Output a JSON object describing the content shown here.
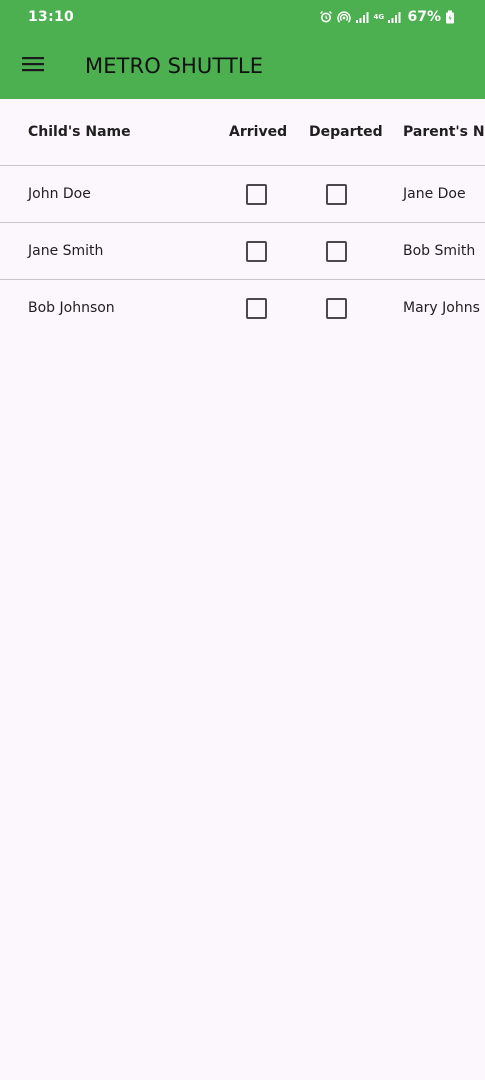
{
  "status_bar": {
    "time": "13:10",
    "icons": [
      "alarm-icon",
      "hotspot-icon",
      "signal-icon",
      "4g-icon",
      "signal-icon"
    ],
    "network_label": "4G",
    "battery_text": "67%",
    "text_color": "#ffffff"
  },
  "app_bar": {
    "title": "METRO SHUTTLE",
    "menu_icon": "menu-icon",
    "background_color": "#4caf50"
  },
  "table": {
    "columns": [
      "Child's Name",
      "Arrived",
      "Departed",
      "Parent's Na"
    ],
    "rows": [
      {
        "child_name": "John Doe",
        "arrived": false,
        "departed": false,
        "parent_name": "Jane Doe"
      },
      {
        "child_name": "Jane Smith",
        "arrived": false,
        "departed": false,
        "parent_name": "Bob Smith"
      },
      {
        "child_name": "Bob Johnson",
        "arrived": false,
        "departed": false,
        "parent_name": "Mary Johns"
      }
    ]
  },
  "colors": {
    "page_background": "#fcf7fc",
    "divider": "#c8c8c8",
    "checkbox_border": "#4a4a4a"
  }
}
